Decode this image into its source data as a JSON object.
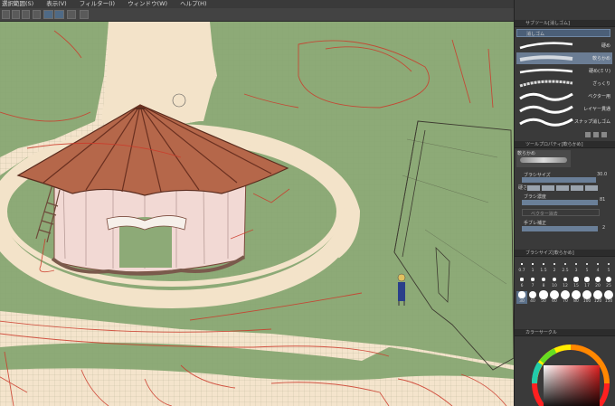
{
  "menu": {
    "items": [
      "選択範囲(S)",
      "表示(V)",
      "フィルター(I)",
      "ウィンドウ(W)",
      "ヘルプ(H)"
    ]
  },
  "subtool_panel": {
    "title": "サブツール[消しゴム]",
    "group": "消しゴム",
    "brushes": [
      "硬め",
      "軟らかめ",
      "硬め(ミリ)",
      "ざっくり",
      "ベクター用",
      "レイヤー貫通",
      "スナップ消しゴム"
    ]
  },
  "tool_property": {
    "title": "ツールプロパティ[軟らかめ]",
    "tool_name": "軟らかめ",
    "brush_size_label": "ブラシサイズ",
    "brush_size_value": "30.0",
    "hardness_label": "硬さ",
    "density_label": "ブラシ濃度",
    "density_value": "81",
    "vector_erase_label": "ベクター消去",
    "stabilization_label": "手ブレ補正",
    "stabilization_value": "2"
  },
  "brush_size_panel": {
    "title": "ブラシサイズ[軟らかめ]",
    "sizes": [
      "0.7",
      "1",
      "1.5",
      "2",
      "2.5",
      "3",
      "5",
      "4",
      "5",
      "6",
      "7",
      "8",
      "10",
      "12",
      "15",
      "17",
      "20",
      "25",
      "30",
      "40",
      "50",
      "60",
      "70",
      "80",
      "100",
      "120",
      "150"
    ],
    "selected": "30"
  },
  "color_panel": {
    "title": "カラーサークル"
  }
}
